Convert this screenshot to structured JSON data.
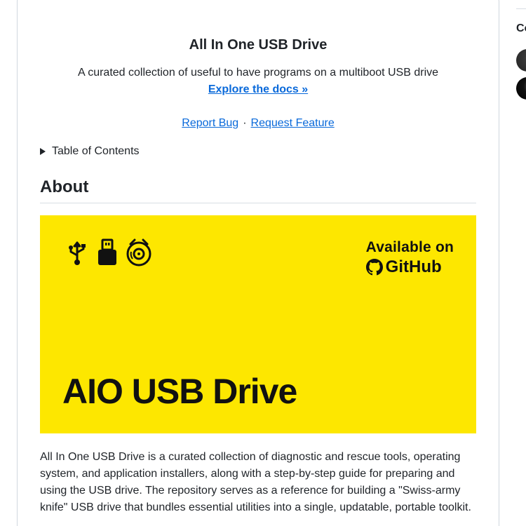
{
  "readme": {
    "title": "All In One USB Drive",
    "tagline": "A curated collection of useful to have programs on a multiboot USB drive",
    "docs_link": "Explore the docs »",
    "report_bug": "Report Bug",
    "separator": "·",
    "request_feature": "Request Feature",
    "toc_label": "Table of Contents",
    "about_heading": "About",
    "banner": {
      "available_on": "Available on",
      "github": "GitHub",
      "big_title": "AIO USB Drive",
      "background_color": "#fde700",
      "icons": [
        "usb-icon",
        "usb-drive-icon",
        "disc-icon"
      ]
    },
    "description": "All In One USB Drive is a curated collection of diagnostic and rescue tools, operating system, and application installers, along with a step-by-step guide for preparing and using the USB drive. The repository serves as a reference for building a \"Swiss-army knife\" USB drive that bundles essential utilities into a single, updatable, portable toolkit."
  },
  "sidebar": {
    "heading": "Co"
  },
  "colors": {
    "link": "#0969da",
    "text": "#1f2328",
    "border": "#d0d7de"
  }
}
